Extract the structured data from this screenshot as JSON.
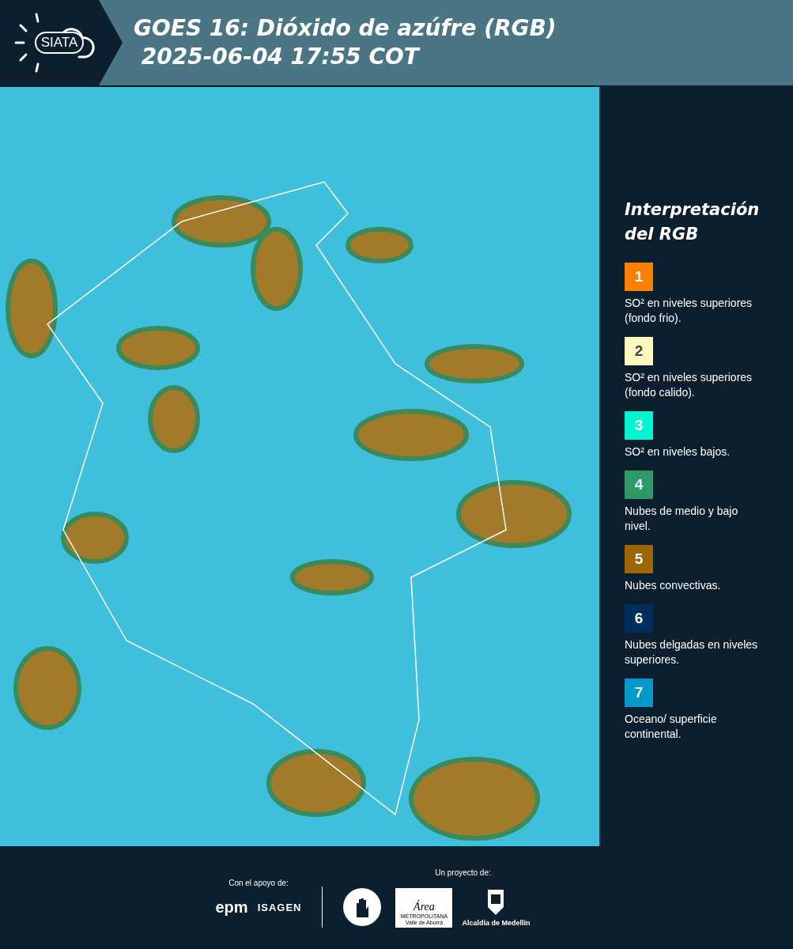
{
  "header": {
    "logo_text": "SIATA",
    "title_line_1": "GOES 16: Dióxido de azúfre (RGB)",
    "title_line_2": "2025-06-04 17:55 COT"
  },
  "legend": {
    "title": "Interpretación del RGB",
    "items": [
      {
        "number": "1",
        "color": "#ff8000",
        "text": "SO² en niveles superiores (fondo frio)."
      },
      {
        "number": "2",
        "color": "#fff9c0",
        "text": "SO² en niveles superiores (fondo calido)."
      },
      {
        "number": "3",
        "color": "#00f5d0",
        "text": "SO² en niveles bajos."
      },
      {
        "number": "4",
        "color": "#2e9966",
        "text": "Nubes de medio y bajo nivel."
      },
      {
        "number": "5",
        "color": "#9e6600",
        "text": "Nubes convectivas."
      },
      {
        "number": "6",
        "color": "#002f5e",
        "text": "Nubes delgadas en niveles superiores."
      },
      {
        "number": "7",
        "color": "#0099cc",
        "text": "Oceano/ superficie continental."
      }
    ]
  },
  "footer": {
    "support_label": "Con el apoyo de:",
    "support_logos": [
      "epm",
      "ISAGEN"
    ],
    "project_label": "Un proyecto de:",
    "area_logo": {
      "name": "Área",
      "line_1": "METROPOLITANA",
      "line_2": "Valle de Aburrá"
    },
    "alcaldia_logo": "Alcaldía de Medellín"
  }
}
